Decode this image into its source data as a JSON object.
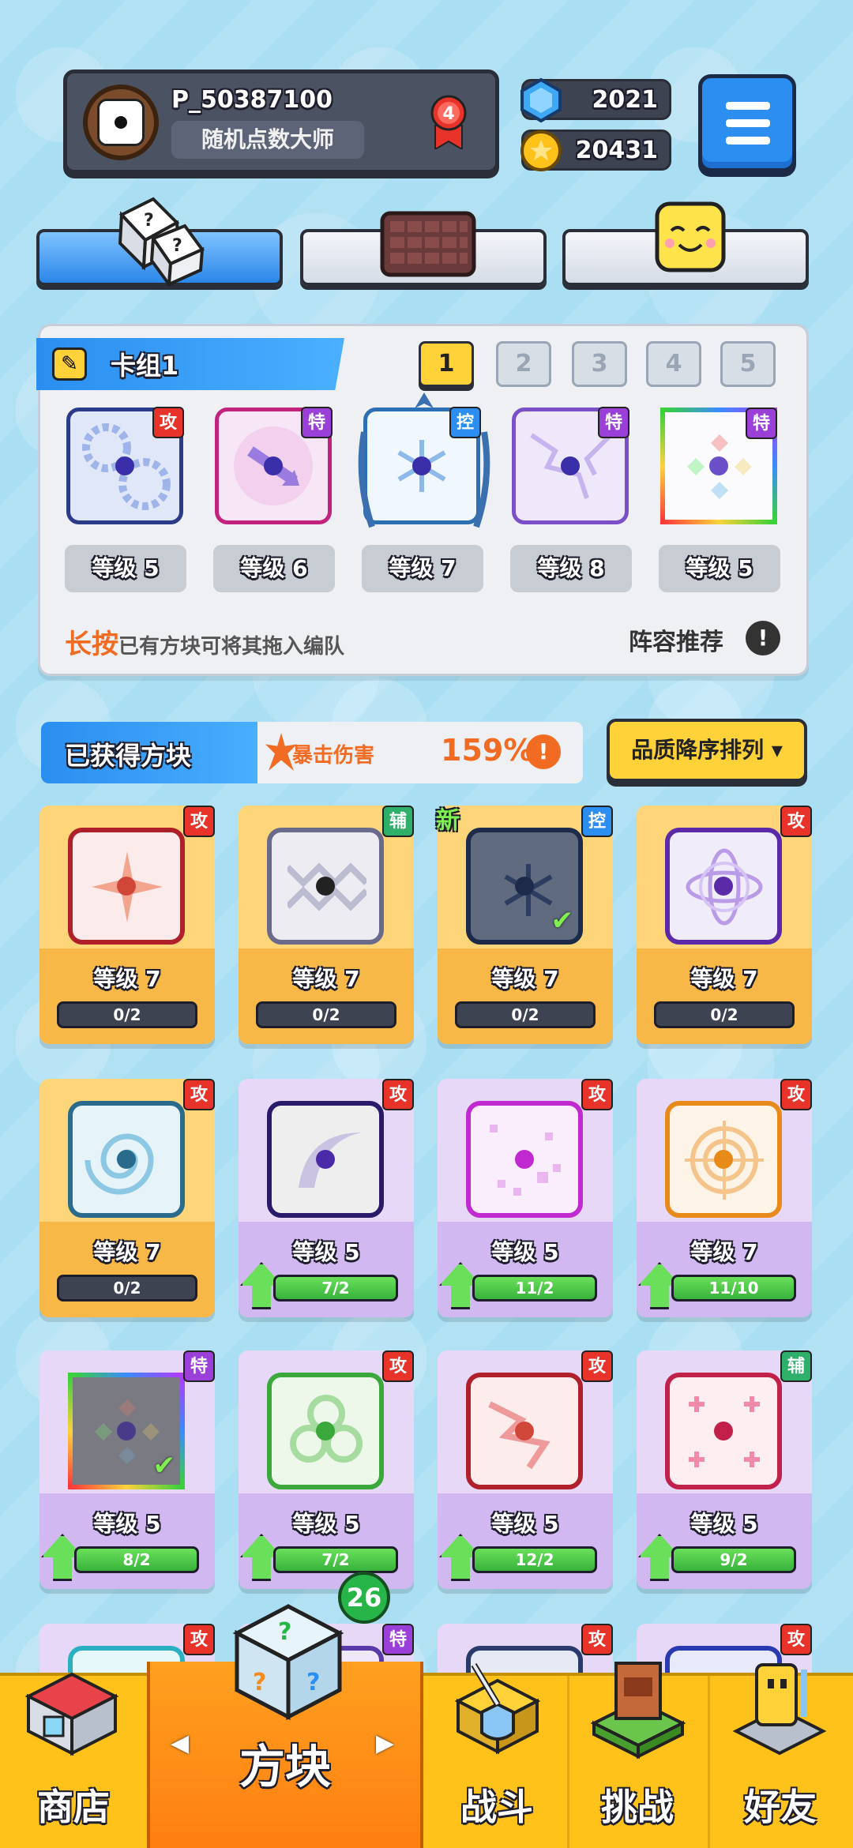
{
  "header": {
    "player_name": "P_50387100",
    "player_title": "随机点数大师",
    "rank_level": "4",
    "gems": "2021",
    "coins": "20431"
  },
  "deck": {
    "title": "卡组1",
    "decks": [
      "1",
      "2",
      "3",
      "4",
      "5"
    ],
    "selected_deck": "1",
    "cards": [
      {
        "tag": "攻",
        "level": "等级 5"
      },
      {
        "tag": "特",
        "level": "等级 6"
      },
      {
        "tag": "控",
        "level": "等级 7"
      },
      {
        "tag": "特",
        "level": "等级 8"
      },
      {
        "tag": "特",
        "level": "等级 5"
      }
    ],
    "hint_highlight": "长按",
    "hint_text": "已有方块可将其拖入编队",
    "recommend_label": "阵容推荐",
    "recommend_icon": "!"
  },
  "obtained": {
    "title": "已获得方块",
    "crit_label": "暴击伤害",
    "crit_value": "159%",
    "crit_icon": "!",
    "sort_label": "品质降序排列 ▾",
    "new_label": "新",
    "cards": [
      {
        "tag": "攻",
        "level": "等级 7",
        "progress": "0/2"
      },
      {
        "tag": "辅",
        "level": "等级 7",
        "progress": "0/2"
      },
      {
        "tag": "控",
        "level": "等级 7",
        "progress": "0/2"
      },
      {
        "tag": "攻",
        "level": "等级 7",
        "progress": "0/2"
      },
      {
        "tag": "攻",
        "level": "等级 7",
        "progress": "0/2"
      },
      {
        "tag": "攻",
        "level": "等级 5",
        "progress": "7/2"
      },
      {
        "tag": "攻",
        "level": "等级 5",
        "progress": "11/2"
      },
      {
        "tag": "攻",
        "level": "等级 7",
        "progress": "11/10"
      },
      {
        "tag": "特",
        "level": "等级 5",
        "progress": "8/2"
      },
      {
        "tag": "攻",
        "level": "等级 5",
        "progress": "7/2"
      },
      {
        "tag": "攻",
        "level": "等级 5",
        "progress": "12/2"
      },
      {
        "tag": "辅",
        "level": "等级 5",
        "progress": "9/2"
      },
      {
        "tag": "攻"
      },
      {
        "tag": "特"
      },
      {
        "tag": "攻"
      },
      {
        "tag": "攻"
      }
    ]
  },
  "nav": {
    "shop": "商店",
    "blocks": "方块",
    "battle": "战斗",
    "challenge": "挑战",
    "friends": "好友",
    "blocks_badge": "26",
    "arrow_left": "◀",
    "arrow_right": "▶"
  },
  "colors": {
    "accent_blue": "#2b8ef0",
    "gold": "#ffd23a",
    "attack_tag": "#e8332a",
    "special_tag": "#9a3fd8",
    "control_tag": "#2b8ef0",
    "support_tag": "#2fb06a"
  },
  "icons": [
    "dice-avatar-icon",
    "rank-badge-icon",
    "gem-icon",
    "coin-icon",
    "menu-icon",
    "dice-tab-icon",
    "board-tab-icon",
    "emoji-tab-icon",
    "pencil-icon",
    "shop-icon",
    "mystery-cube-icon",
    "sword-shield-icon",
    "challenge-tower-icon",
    "friend-robot-icon"
  ]
}
